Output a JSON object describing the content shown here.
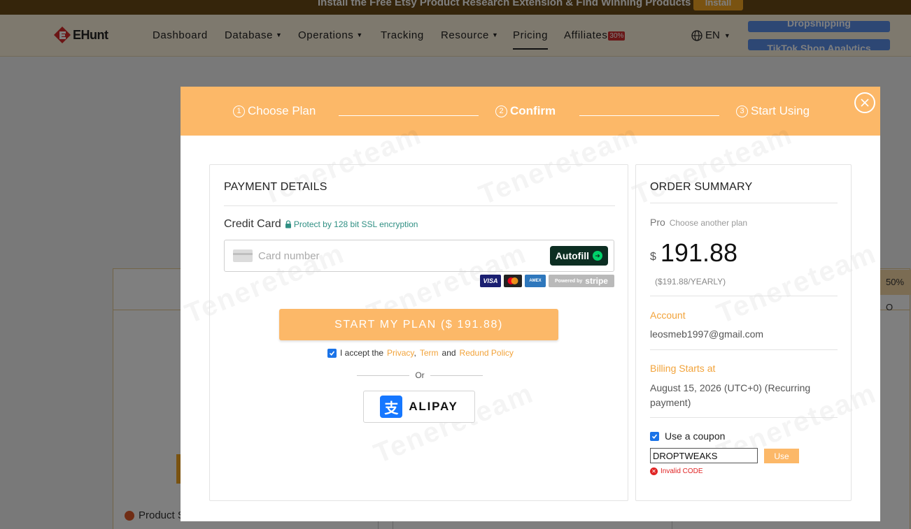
{
  "banner": {
    "text": "Install the Free Etsy Product Research Extension & Find Winning Products Faster",
    "install_label": "Install"
  },
  "nav": {
    "logo_text": "EHunt",
    "items": [
      {
        "label": "Dashboard",
        "dropdown": false
      },
      {
        "label": "Database",
        "dropdown": true
      },
      {
        "label": "Operations",
        "dropdown": true
      },
      {
        "label": "Tracking",
        "dropdown": false
      },
      {
        "label": "Resource",
        "dropdown": true
      },
      {
        "label": "Pricing",
        "dropdown": false,
        "active": true
      },
      {
        "label": "Affiliates",
        "dropdown": false,
        "badge": "30%"
      }
    ],
    "language": "EN",
    "side_buttons": [
      "Dropshipping",
      "TikTok Shop Analytics"
    ]
  },
  "background": {
    "product_label": "Product S",
    "discount_tag": "50% O"
  },
  "modal": {
    "steps": [
      {
        "num": "1",
        "label": "Choose Plan",
        "active": false
      },
      {
        "num": "2",
        "label": "Confirm",
        "active": true
      },
      {
        "num": "3",
        "label": "Start Using",
        "active": false
      }
    ],
    "watermark": "Tenereteam",
    "payment": {
      "title": "PAYMENT DETAILS",
      "credit_card_label": "Credit Card",
      "ssl_text": "Protect by 128 bit SSL encryption",
      "card_placeholder": "Card number",
      "autofill_label": "Autofill",
      "brands": [
        "VISA",
        "Mastercard",
        "AMEX"
      ],
      "powered_by": "Powered by",
      "stripe": "stripe",
      "start_button": "START MY PLAN ($ 191.88)",
      "accept_prefix": "I accept the",
      "privacy": "Privacy",
      "comma": ",",
      "term": "Term",
      "and": "and",
      "refund": "Redund Policy",
      "or": "Or",
      "alipay": "ALIPAY"
    },
    "summary": {
      "title": "ORDER SUMMARY",
      "plan": "Pro",
      "choose_another": "Choose another plan",
      "currency": "$",
      "price": "191.88",
      "yearly": "($191.88/YEARLY)",
      "account_label": "Account",
      "account_value": "leosmeb1997@gmail.com",
      "billing_label": "Billing Starts at",
      "billing_value": "August 15, 2026 (UTC+0) (Recurring payment)",
      "coupon_label": "Use a coupon",
      "coupon_value": "DROPTWEAKS",
      "use_label": "Use",
      "invalid_text": "Invalid CODE"
    }
  },
  "colors": {
    "accent": "#fcb868",
    "link": "#f2a33a",
    "error": "#e02424",
    "ssl": "#2f8f83"
  }
}
